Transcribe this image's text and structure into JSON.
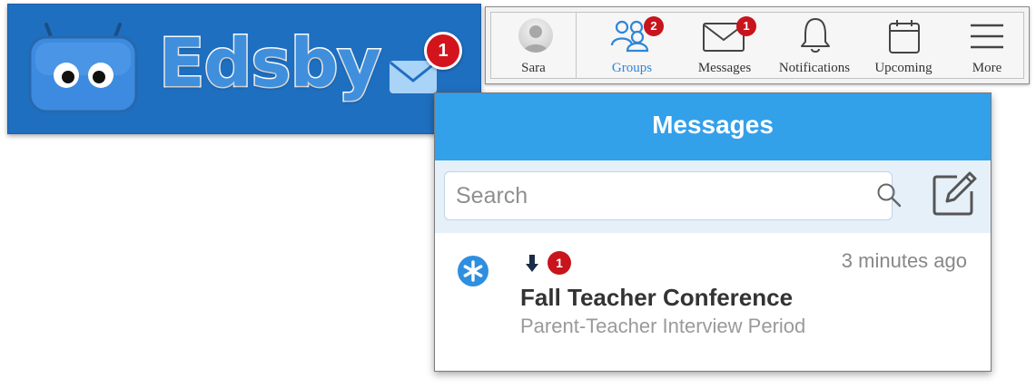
{
  "brand": {
    "name": "Edsby",
    "mail_badge": "1",
    "colors": {
      "banner_bg": "#1f6fc0",
      "logo_fill": "#3f8fdd",
      "badge": "#d4141c"
    }
  },
  "toolbar": {
    "items": [
      {
        "label": "Sara",
        "icon": "user-avatar",
        "badge": ""
      },
      {
        "label": "Groups",
        "icon": "groups-icon",
        "badge": "2",
        "active": true
      },
      {
        "label": "Messages",
        "icon": "envelope-icon",
        "badge": "1"
      },
      {
        "label": "Notifications",
        "icon": "bell-icon",
        "badge": ""
      },
      {
        "label": "Upcoming",
        "icon": "calendar-icon",
        "badge": ""
      },
      {
        "label": "More",
        "icon": "menu-icon",
        "badge": ""
      }
    ],
    "active_color": "#2e86d6"
  },
  "messages_panel": {
    "title": "Messages",
    "header_color": "#33a0ea",
    "search": {
      "placeholder": "Search",
      "value": ""
    },
    "items": [
      {
        "icon": "asterisk-icon",
        "unread_count": "1",
        "time": "3 minutes ago",
        "title": "Fall Teacher Conference",
        "subtitle": "Parent-Teacher Interview Period"
      }
    ]
  }
}
